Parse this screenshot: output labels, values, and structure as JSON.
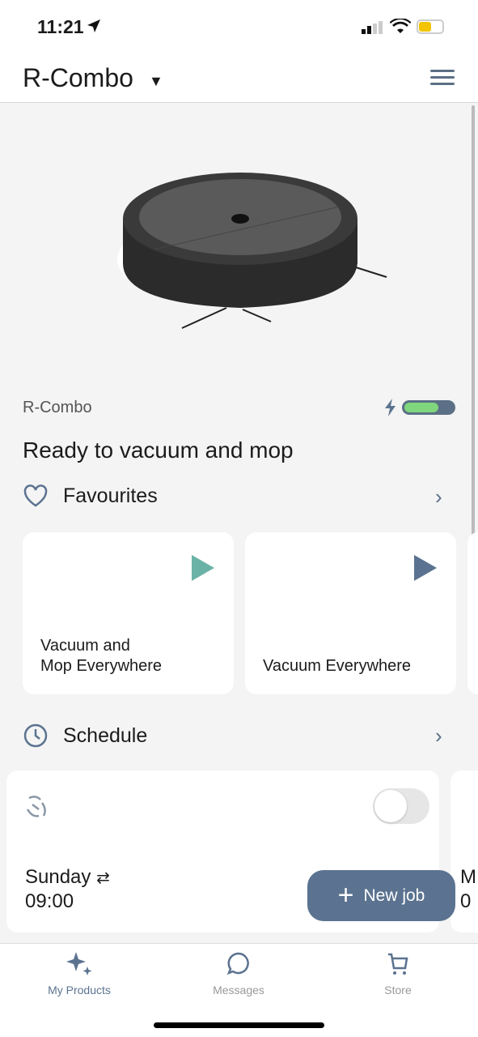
{
  "status_bar": {
    "time": "11:21"
  },
  "header": {
    "title": "R-Combo"
  },
  "product": {
    "name": "R-Combo",
    "battery_percent": 70,
    "status": "Ready to vacuum and mop"
  },
  "favourites": {
    "title": "Favourites",
    "items": [
      {
        "label_line1": "Vacuum and",
        "label_line2": "Mop Everywhere",
        "play_color": "#6bb3a6"
      },
      {
        "label_line1": "",
        "label_line2": "Vacuum Everywhere",
        "play_color": "#5b7390"
      }
    ]
  },
  "schedule": {
    "title": "Schedule",
    "items": [
      {
        "day": "Sunday",
        "time": "09:00",
        "enabled": false
      }
    ],
    "next_peek": {
      "day": "M",
      "time": "0"
    }
  },
  "new_job": {
    "label": "New job"
  },
  "tabs": [
    {
      "label": "My Products",
      "active": true
    },
    {
      "label": "Messages"
    },
    {
      "label": "Store"
    }
  ],
  "colors": {
    "accent": "#5b7390",
    "battery": "#7fd67d"
  }
}
